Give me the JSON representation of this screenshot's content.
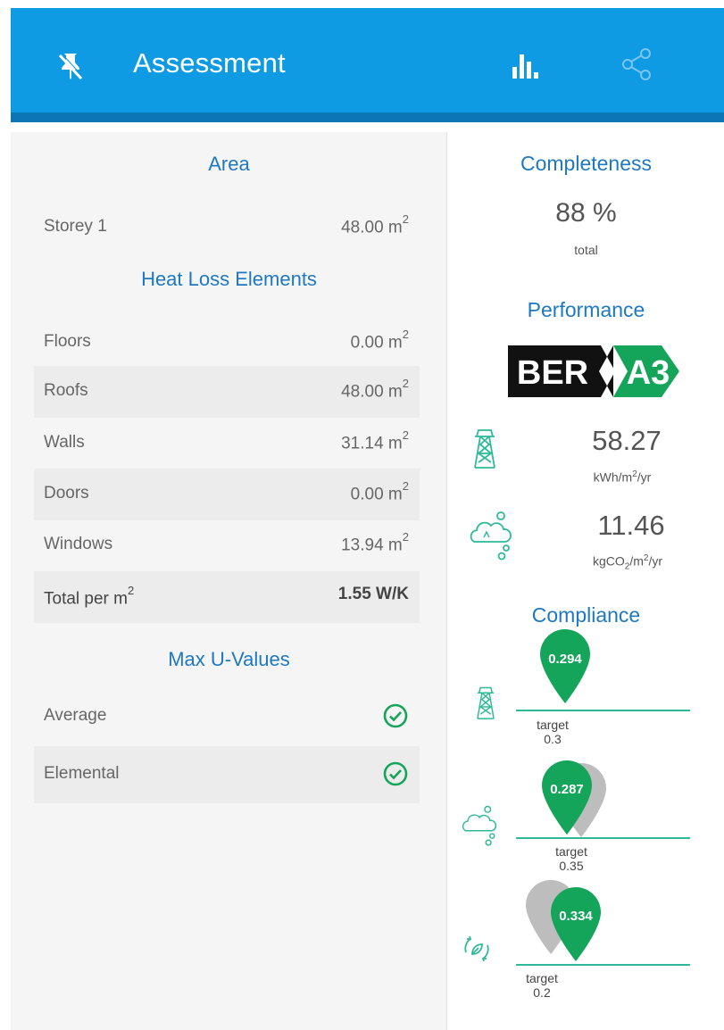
{
  "header": {
    "title": "Assessment",
    "accent": "#0f9be3",
    "icons": [
      "pin-off-icon",
      "bar-chart-icon",
      "share-icon"
    ]
  },
  "area": {
    "title": "Area",
    "rows": [
      {
        "label": "Storey 1",
        "value": "48.00 m",
        "unit_sup": "2"
      }
    ]
  },
  "heat_loss": {
    "title": "Heat Loss Elements",
    "rows": [
      {
        "label": "Floors",
        "value": "0.00 m",
        "unit_sup": "2"
      },
      {
        "label": "Roofs",
        "value": "48.00 m",
        "unit_sup": "2"
      },
      {
        "label": "Walls",
        "value": "31.14 m",
        "unit_sup": "2"
      },
      {
        "label": "Doors",
        "value": "0.00 m",
        "unit_sup": "2"
      },
      {
        "label": "Windows",
        "value": "13.94 m",
        "unit_sup": "2"
      }
    ],
    "total": {
      "label": "Total per m",
      "label_sup": "2",
      "value": "1.55 W/K"
    }
  },
  "max_u": {
    "title": "Max U-Values",
    "rows": [
      {
        "label": "Average",
        "status": "check-circle-icon"
      },
      {
        "label": "Elemental",
        "status": "check-circle-icon"
      }
    ]
  },
  "completeness": {
    "title": "Completeness",
    "value": "88 %",
    "caption": "total"
  },
  "performance": {
    "title": "Performance",
    "ber_label": "BER",
    "ber_grade": "A3",
    "ber_grade_color": "#14a45a",
    "energy": {
      "value": "58.27",
      "unit_a": "kWh/m",
      "unit_sup": "2",
      "unit_b": "/yr"
    },
    "co2": {
      "value": "11.46",
      "unit_a": "kgCO",
      "unit_sub": "2",
      "unit_b": "/m",
      "unit_sup": "2",
      "unit_c": "/yr"
    }
  },
  "compliance": {
    "title": "Compliance",
    "items": [
      {
        "value": "0.294",
        "target_label": "target",
        "target_value": "0.3"
      },
      {
        "value": "0.287",
        "target_label": "target",
        "target_value": "0.35"
      },
      {
        "value": "0.334",
        "target_label": "target",
        "target_value": "0.2"
      }
    ],
    "pin_color": "#14a45a",
    "target_pin_color": "#bdbdbd"
  }
}
